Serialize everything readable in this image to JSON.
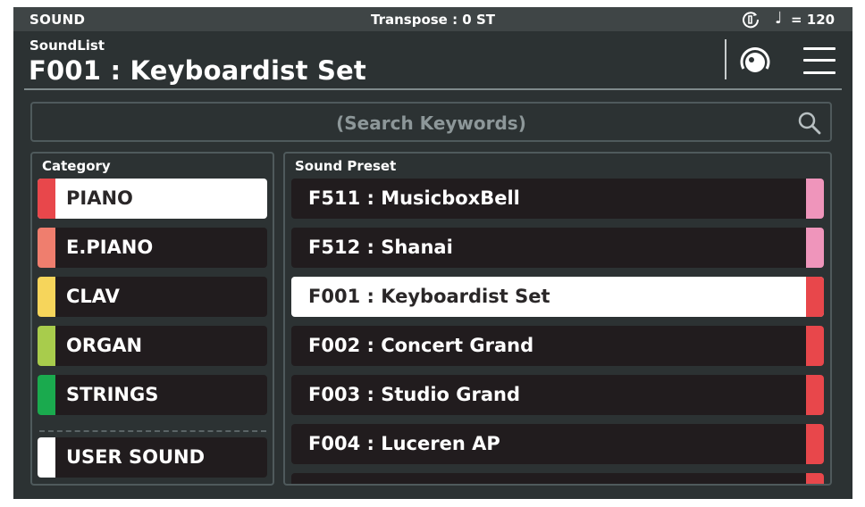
{
  "status_bar": {
    "mode": "SOUND",
    "transpose": "Transpose : 0 ST",
    "tempo_icon": "metronome-icon",
    "note_icon": "quarter-note-icon",
    "note_glyph": "♩",
    "tempo": "= 120"
  },
  "header": {
    "label": "SoundList",
    "current_sound": "F001 : Keyboardist Set",
    "knob_icon": "knob-icon",
    "menu_icon": "hamburger-menu-icon"
  },
  "search": {
    "placeholder": "(Search Keywords)",
    "icon": "search-icon"
  },
  "category": {
    "title": "Category",
    "items": [
      {
        "label": "PIANO",
        "color": "#e8474b",
        "selected": true
      },
      {
        "label": "E.PIANO",
        "color": "#ef7e6e",
        "selected": false
      },
      {
        "label": "CLAV",
        "color": "#f6d55b",
        "selected": false
      },
      {
        "label": "ORGAN",
        "color": "#a8cc4c",
        "selected": false
      },
      {
        "label": "STRINGS",
        "color": "#1aaa4e",
        "selected": false
      },
      {
        "label": "USER SOUND",
        "color": "#ffffff",
        "selected": false
      }
    ]
  },
  "preset": {
    "title": "Sound Preset",
    "items": [
      {
        "label": "F511 : MusicboxBell",
        "color": "#ef95bb",
        "selected": false
      },
      {
        "label": "F512 : Shanai",
        "color": "#ef95bb",
        "selected": false
      },
      {
        "label": "F001 : Keyboardist Set",
        "color": "#e8474b",
        "selected": true
      },
      {
        "label": "F002 : Concert Grand",
        "color": "#e8474b",
        "selected": false
      },
      {
        "label": "F003 : Studio Grand",
        "color": "#e8474b",
        "selected": false
      },
      {
        "label": "F004 : Luceren AP",
        "color": "#e8474b",
        "selected": false
      }
    ]
  }
}
